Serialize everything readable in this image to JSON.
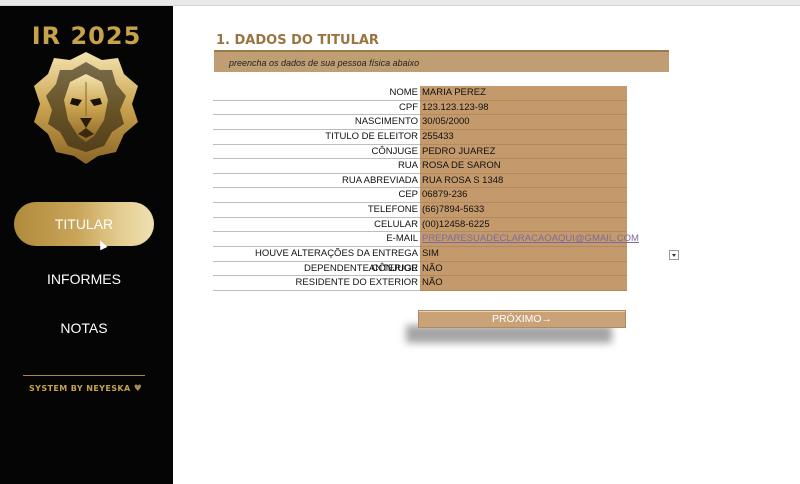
{
  "sidebar": {
    "brand_title": "IR 2025",
    "logo_icon": "lion-head-icon",
    "nav": [
      {
        "label": "TITULAR",
        "active": true
      },
      {
        "label": "INFORMES",
        "active": false
      },
      {
        "label": "NOTAS",
        "active": false
      }
    ],
    "credit": "SYSTEM BY NEYESKA",
    "credit_icon": "heart-icon"
  },
  "section": {
    "title": "1. DADOS DO TITULAR",
    "subtitle": "preencha os dados de sua pessoa física abaixo"
  },
  "form": {
    "rows": [
      {
        "label": "NOME",
        "value": "MARIA PEREZ"
      },
      {
        "label": "CPF",
        "value": "123.123.123-98"
      },
      {
        "label": "NASCIMENTO",
        "value": "30/05/2000"
      },
      {
        "label": "TITULO DE ELEITOR",
        "value": "255433"
      },
      {
        "label": "CÔNJUGE",
        "value": "PEDRO JUAREZ"
      },
      {
        "label": "RUA",
        "value": "ROSA DE SARON"
      },
      {
        "label": "RUA ABREVIADA",
        "value": "RUA ROSA S 1348"
      },
      {
        "label": "CEP",
        "value": "06879-236"
      },
      {
        "label": "TELEFONE",
        "value": "(66)7894-5633"
      },
      {
        "label": "CELULAR",
        "value": "(00)12458-6225"
      },
      {
        "label": "E-MAIL",
        "value": "PREPARESUADECLARACAOAQUI@GMAIL.COM"
      },
      {
        "label": "HOUVE ALTERAÇÕES DA ENTREGA ANTERIOR",
        "value": "SIM"
      },
      {
        "label": "DEPENDENTE CÔNJUGE",
        "value": "NÃO"
      },
      {
        "label": "RESIDENTE DO EXTERIOR",
        "value": "NÃO"
      }
    ]
  },
  "next_button": {
    "label": "PRÓXIMO→"
  },
  "colors": {
    "sidebar_bg": "#050505",
    "gold": "#c7a24a",
    "field_bg": "#c49a6c",
    "title_brown": "#9a7440"
  }
}
